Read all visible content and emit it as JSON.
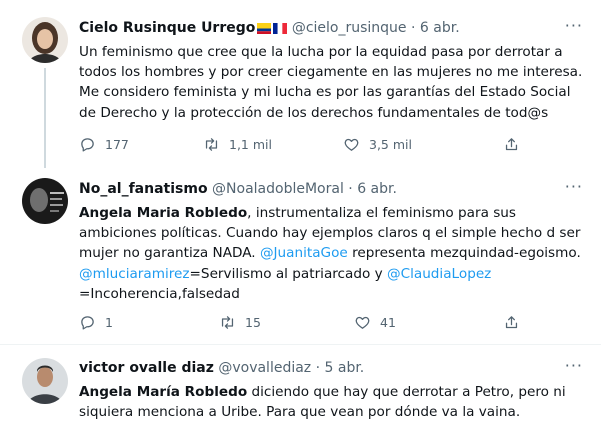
{
  "tweets": [
    {
      "name": "Cielo Rusinque Urrego",
      "handle": "@cielo_rusinque",
      "separator": "·",
      "date": "6 abr.",
      "text": "Un feminismo que cree que la lucha por la equidad pasa por derrotar a todos los hombres y por creer ciegamente en las mujeres no me interesa. Me considero feminista y mi lucha es por las garantías del Estado Social de Derecho y la protección de los derechos fundamentales de tod@s",
      "replies": "177",
      "retweets": "1,1 mil",
      "likes": "3,5 mil"
    },
    {
      "name": "No_al_fanatismo",
      "handle": "@NoaladobleMoral",
      "separator": "·",
      "date": "6 abr.",
      "text_parts": {
        "bold1": "Angela Maria Robledo",
        "t1": ", instrumentaliza el feminismo para sus ambiciones políticas. Cuando hay ejemplos claros q el simple hecho d ser mujer no garantiza NADA. ",
        "m1": "@JuanitaGoe",
        "t2": " representa mezquindad-egoismo. ",
        "m2": "@mluciaramirez",
        "t3": "=Servilismo al patriarcado y ",
        "m3": "@ClaudiaLopez",
        "t4": " =Incoherencia,falsedad"
      },
      "replies": "1",
      "retweets": "15",
      "likes": "41"
    },
    {
      "name": "victor ovalle diaz",
      "handle": "@vovallediaz",
      "separator": "·",
      "date": "5 abr.",
      "text_parts": {
        "bold1": "Angela María Robledo",
        "t1": " diciendo que hay que derrotar a Petro, pero ni siquiera menciona a Uribe. Para que vean por dónde va la vaina."
      }
    }
  ],
  "more_label": "···",
  "colors": {
    "accent": "#1d9bf0",
    "muted": "#536471",
    "text": "#0f1419",
    "line": "#cfd9de"
  }
}
